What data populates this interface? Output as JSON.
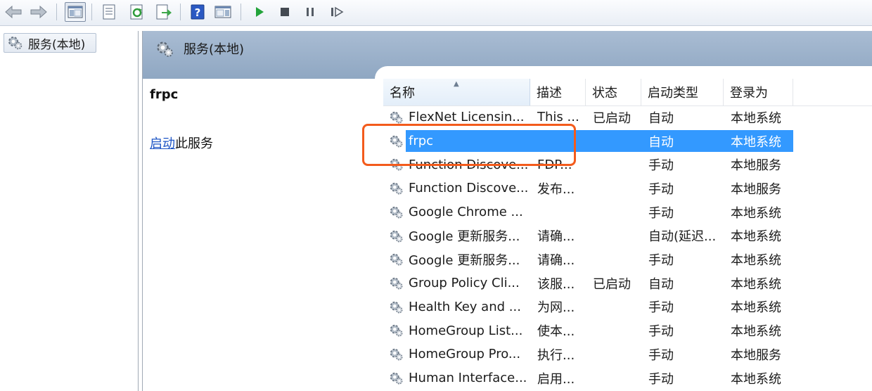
{
  "toolbar": {
    "icons": [
      "back-arrow-icon",
      "forward-arrow-icon",
      "show-hide-console-tree-icon",
      "properties-icon",
      "refresh-icon",
      "export-list-icon",
      "help-icon",
      "action-pane-icon",
      "start-service-icon",
      "stop-service-icon",
      "pause-service-icon",
      "resume-service-icon"
    ]
  },
  "tree": {
    "root_label": "服务(本地)"
  },
  "panel": {
    "header_title": "服务(本地)",
    "selected_service_name": "frpc",
    "start_link": "启动",
    "start_suffix": "此服务"
  },
  "table": {
    "columns": [
      {
        "label": "名称"
      },
      {
        "label": "描述"
      },
      {
        "label": "状态"
      },
      {
        "label": "启动类型"
      },
      {
        "label": "登录为"
      }
    ],
    "rows": [
      {
        "name": "FlexNet Licensin...",
        "desc": "This ...",
        "status": "已启动",
        "startup": "自动",
        "logon": "本地系统"
      },
      {
        "name": "frpc",
        "desc": "",
        "status": "",
        "startup": "自动",
        "logon": "本地系统",
        "selected": true
      },
      {
        "name": "Function Discove...",
        "desc": "FDP...",
        "status": "",
        "startup": "手动",
        "logon": "本地服务"
      },
      {
        "name": "Function Discove...",
        "desc": "发布...",
        "status": "",
        "startup": "手动",
        "logon": "本地服务"
      },
      {
        "name": "Google Chrome ...",
        "desc": "",
        "status": "",
        "startup": "手动",
        "logon": "本地系统"
      },
      {
        "name": "Google 更新服务...",
        "desc": "请确...",
        "status": "",
        "startup": "自动(延迟...",
        "logon": "本地系统"
      },
      {
        "name": "Google 更新服务...",
        "desc": "请确...",
        "status": "",
        "startup": "手动",
        "logon": "本地系统"
      },
      {
        "name": "Group Policy Cli...",
        "desc": "该服...",
        "status": "已启动",
        "startup": "自动",
        "logon": "本地系统"
      },
      {
        "name": "Health Key and ...",
        "desc": "为网...",
        "status": "",
        "startup": "手动",
        "logon": "本地系统"
      },
      {
        "name": "HomeGroup List...",
        "desc": "使本...",
        "status": "",
        "startup": "手动",
        "logon": "本地系统"
      },
      {
        "name": "HomeGroup Pro...",
        "desc": "执行...",
        "status": "",
        "startup": "手动",
        "logon": "本地服务"
      },
      {
        "name": "Human Interface...",
        "desc": "启用...",
        "status": "",
        "startup": "手动",
        "logon": "本地系统"
      }
    ]
  },
  "colors": {
    "selection": "#3399ff",
    "annotation": "#f35b1c",
    "header_band": "#9fb4cd",
    "link": "#1d54c5"
  }
}
